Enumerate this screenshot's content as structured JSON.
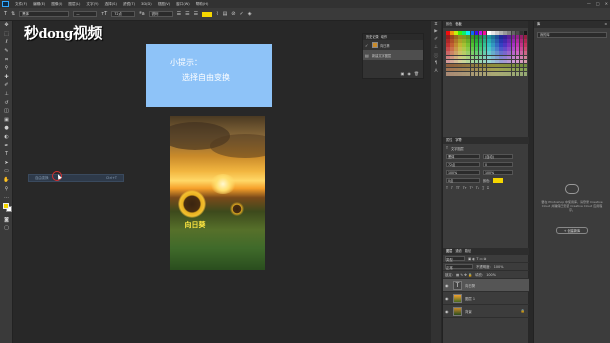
{
  "menubar": {
    "items": [
      "文件(F)",
      "编辑(E)",
      "图像(I)",
      "图层(L)",
      "文字(Y)",
      "选择(S)",
      "滤镜(T)",
      "3D(D)",
      "视图(V)",
      "窗口(W)",
      "帮助(H)"
    ],
    "window_controls": [
      "—",
      "□",
      "✕"
    ]
  },
  "options_bar": {
    "font_family": "黑体",
    "font_style": "—",
    "font_size": "72点",
    "anti_alias": "锐利",
    "color": "#f5d600"
  },
  "watermark": {
    "part1": "秒",
    "part2": "dong",
    "part3": "视频"
  },
  "tip": {
    "line1": "小提示：",
    "line2": "选择自由变换"
  },
  "canvas": {
    "caption": "向日葵",
    "transform_field_label": "自由变换",
    "transform_field_shortcut": "Ctrl+T"
  },
  "history_panel": {
    "tabs": [
      "历史记录",
      "动作"
    ],
    "rows": [
      {
        "label": "向日葵"
      },
      {
        "label": "新建文字图层"
      }
    ]
  },
  "swatches_panel": {
    "tabs": [
      "颜色",
      "色板"
    ]
  },
  "character_panel": {
    "tabs": [
      "属性",
      "字符"
    ],
    "header": "文字图层",
    "font": "黑体",
    "size": "72点",
    "leading": "(自动)",
    "tracking": "0",
    "scale_v": "100%",
    "scale_h": "100%",
    "baseline": "0点",
    "color_label": "颜色:"
  },
  "layers_panel": {
    "tabs": [
      "图层",
      "通道",
      "路径"
    ],
    "kind_label": "类型",
    "blend_mode": "正常",
    "opacity_label": "不透明度:",
    "opacity": "100%",
    "lock_label": "锁定:",
    "fill_label": "填充:",
    "fill": "100%",
    "layers": [
      {
        "name": "向日葵",
        "type": "text"
      },
      {
        "name": "图层 1",
        "type": "image"
      },
      {
        "name": "背景",
        "type": "background"
      }
    ]
  },
  "library_panel": {
    "tab": "库",
    "select": "我的库",
    "message": "要在 Photoshop 中使用库，请登录 Creative Cloud 并确保已安装 Creative Cloud 应用程序。",
    "button": "+ 创建新库"
  }
}
